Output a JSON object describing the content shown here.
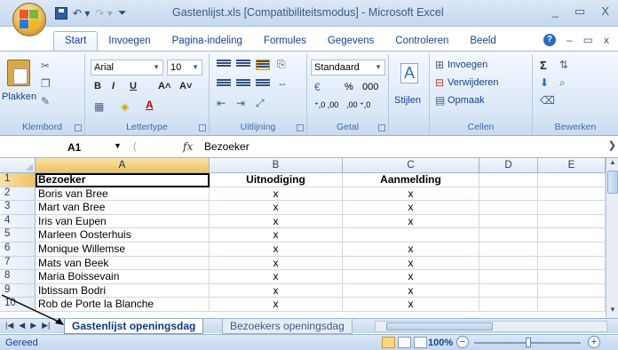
{
  "window": {
    "title": "Gastenlijst.xls  [Compatibiliteitsmodus] - Microsoft Excel",
    "minimize": "_",
    "restore": "▭",
    "close": "X"
  },
  "ribbon_tabs": [
    "Start",
    "Invoegen",
    "Pagina-indeling",
    "Formules",
    "Gegevens",
    "Controleren",
    "Beeld"
  ],
  "ribbon": {
    "clipboard": {
      "paste": "Plakken",
      "group": "Klembord"
    },
    "font": {
      "name": "Arial",
      "size": "10",
      "group": "Lettertype",
      "bold": "B",
      "italic": "I",
      "underline": "U",
      "grow": "A˄",
      "shrink": "A˅"
    },
    "alignment": {
      "group": "Uitlijning"
    },
    "number": {
      "format": "Standaard",
      "percent": "%",
      "thousands": "000",
      "inc": "⁺,0 ,00",
      "dec": ",00 ⁺,0",
      "group": "Getal"
    },
    "styles": {
      "label": "Stijlen"
    },
    "cells": {
      "insert": "Invoegen",
      "delete": "Verwijderen",
      "format": "Opmaak",
      "group": "Cellen"
    },
    "editing": {
      "sum": "Σ",
      "group": "Bewerken"
    }
  },
  "formula_bar": {
    "name_box": "A1",
    "fx": "fx",
    "content": "Bezoeker"
  },
  "columns": [
    "A",
    "B",
    "C",
    "D",
    "E"
  ],
  "rows": [
    {
      "num": "1",
      "a": "Bezoeker",
      "b": "Uitnodiging",
      "c": "Aanmelding"
    },
    {
      "num": "2",
      "a": "Boris van Bree",
      "b": "x",
      "c": "x"
    },
    {
      "num": "3",
      "a": "Mart van Bree",
      "b": "x",
      "c": "x"
    },
    {
      "num": "4",
      "a": "Iris van Eupen",
      "b": "x",
      "c": "x"
    },
    {
      "num": "5",
      "a": "Marleen Oosterhuis",
      "b": "x",
      "c": ""
    },
    {
      "num": "6",
      "a": "Monique Willemse",
      "b": "x",
      "c": "x"
    },
    {
      "num": "7",
      "a": "Mats van Beek",
      "b": "x",
      "c": "x"
    },
    {
      "num": "8",
      "a": "Maria Boissevain",
      "b": "x",
      "c": "x"
    },
    {
      "num": "9",
      "a": "Ibtissam Bodri",
      "b": "x",
      "c": "x"
    },
    {
      "num": "10",
      "a": "Rob de Porte la Blanche",
      "b": "x",
      "c": "x"
    }
  ],
  "sheets": [
    "Gastenlijst openingsdag",
    "Bezoekers openingsdag"
  ],
  "status": {
    "text": "Gereed",
    "zoom": "100%",
    "minus": "−",
    "plus": "+"
  }
}
